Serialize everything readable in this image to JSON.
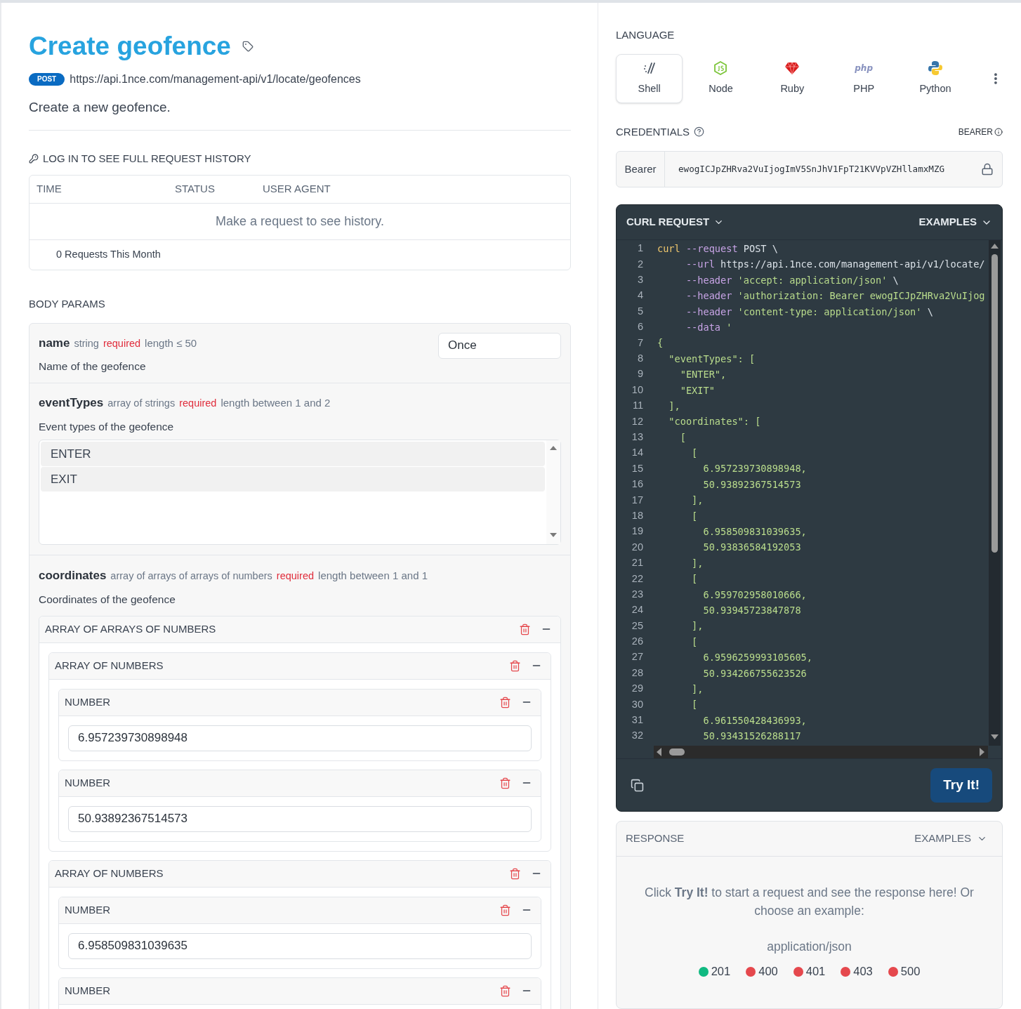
{
  "endpoint": {
    "title": "Create geofence",
    "method": "POST",
    "url": "https://api.1nce.com/management-api/v1/locate/geofences",
    "description": "Create a new geofence."
  },
  "history": {
    "heading": "LOG IN TO SEE FULL REQUEST HISTORY",
    "columns": [
      "TIME",
      "STATUS",
      "USER AGENT"
    ],
    "empty_message": "Make a request to see history.",
    "footer": "0 Requests This Month"
  },
  "body_params": {
    "heading": "BODY PARAMS",
    "params": [
      {
        "kind": "text",
        "name": "name",
        "type": "string",
        "required": "required",
        "constraint": "length ≤ 50",
        "description": "Name of the geofence",
        "value": "Once"
      },
      {
        "kind": "list",
        "name": "eventTypes",
        "type": "array of strings",
        "required": "required",
        "constraint": "length between 1 and 2",
        "description": "Event types of the geofence",
        "items": [
          "ENTER",
          "EXIT"
        ]
      },
      {
        "kind": "nested",
        "name": "coordinates",
        "type": "array of arrays of arrays of numbers",
        "required": "required",
        "constraint": "length between 1 and 1",
        "description": "Coordinates of the geofence",
        "groups": [
          {
            "label": "ARRAY OF ARRAYS OF NUMBERS",
            "children": [
              {
                "label": "ARRAY OF NUMBERS",
                "children": [
                  {
                    "label": "NUMBER",
                    "value": "6.957239730898948"
                  },
                  {
                    "label": "NUMBER",
                    "value": "50.93892367514573"
                  }
                ]
              },
              {
                "label": "ARRAY OF NUMBERS",
                "children": [
                  {
                    "label": "NUMBER",
                    "value": "6.958509831039635"
                  },
                  {
                    "label": "NUMBER"
                  }
                ]
              }
            ]
          }
        ]
      }
    ]
  },
  "language": {
    "heading": "LANGUAGE",
    "options": [
      {
        "label": "Shell",
        "kind": "shell",
        "selected": true
      },
      {
        "label": "Node",
        "kind": "node",
        "selected": false
      },
      {
        "label": "Ruby",
        "kind": "ruby",
        "selected": false
      },
      {
        "label": "PHP",
        "kind": "php",
        "logo_text": "php",
        "selected": false
      },
      {
        "label": "Python",
        "kind": "python",
        "selected": false
      }
    ]
  },
  "credentials": {
    "heading": "CREDENTIALS",
    "auth_type": "BEARER",
    "prefix": "Bearer",
    "token": "ewogICJpZHRva2VuIjogImV5SnJhV1FpT21KVVpVZHllamxMZG"
  },
  "request": {
    "title": "CURL REQUEST",
    "examples": "EXAMPLES",
    "try_button": "Try It!",
    "lines": [
      {
        "number": "1",
        "tokens": [
          {
            "kind": "command",
            "text": "curl"
          },
          {
            "kind": "flag",
            "text": " --request"
          },
          {
            "kind": "plain",
            "text": " POST \\"
          }
        ]
      },
      {
        "number": "2",
        "tokens": [
          {
            "kind": "flag",
            "text": "     --url"
          },
          {
            "kind": "plain",
            "text": " https://api.1nce.com/management-api/v1/locate/"
          }
        ]
      },
      {
        "number": "3",
        "tokens": [
          {
            "kind": "flag",
            "text": "     --header"
          },
          {
            "kind": "string",
            "text": " 'accept: application/json'"
          },
          {
            "kind": "plain",
            "text": " \\"
          }
        ]
      },
      {
        "number": "4",
        "tokens": [
          {
            "kind": "flag",
            "text": "     --header"
          },
          {
            "kind": "string",
            "text": " 'authorization: Bearer ewogICJpZHRva2VuIjog"
          }
        ]
      },
      {
        "number": "5",
        "tokens": [
          {
            "kind": "flag",
            "text": "     --header"
          },
          {
            "kind": "string",
            "text": " 'content-type: application/json'"
          },
          {
            "kind": "plain",
            "text": " \\"
          }
        ]
      },
      {
        "number": "6",
        "tokens": [
          {
            "kind": "flag",
            "text": "     --data"
          },
          {
            "kind": "string",
            "text": " '"
          }
        ]
      },
      {
        "number": "7",
        "tokens": [
          {
            "kind": "string",
            "text": "{"
          }
        ]
      },
      {
        "number": "8",
        "tokens": [
          {
            "kind": "string",
            "text": "  \"eventTypes\": ["
          }
        ]
      },
      {
        "number": "9",
        "tokens": [
          {
            "kind": "string",
            "text": "    \"ENTER\","
          }
        ]
      },
      {
        "number": "10",
        "tokens": [
          {
            "kind": "string",
            "text": "    \"EXIT\""
          }
        ]
      },
      {
        "number": "11",
        "tokens": [
          {
            "kind": "string",
            "text": "  ],"
          }
        ]
      },
      {
        "number": "12",
        "tokens": [
          {
            "kind": "string",
            "text": "  \"coordinates\": ["
          }
        ]
      },
      {
        "number": "13",
        "tokens": [
          {
            "kind": "string",
            "text": "    ["
          }
        ]
      },
      {
        "number": "14",
        "tokens": [
          {
            "kind": "string",
            "text": "      ["
          }
        ]
      },
      {
        "number": "15",
        "tokens": [
          {
            "kind": "string",
            "text": "        6.957239730898948,"
          }
        ]
      },
      {
        "number": "16",
        "tokens": [
          {
            "kind": "string",
            "text": "        50.93892367514573"
          }
        ]
      },
      {
        "number": "17",
        "tokens": [
          {
            "kind": "string",
            "text": "      ],"
          }
        ]
      },
      {
        "number": "18",
        "tokens": [
          {
            "kind": "string",
            "text": "      ["
          }
        ]
      },
      {
        "number": "19",
        "tokens": [
          {
            "kind": "string",
            "text": "        6.958509831039635,"
          }
        ]
      },
      {
        "number": "20",
        "tokens": [
          {
            "kind": "string",
            "text": "        50.93836584192053"
          }
        ]
      },
      {
        "number": "21",
        "tokens": [
          {
            "kind": "string",
            "text": "      ],"
          }
        ]
      },
      {
        "number": "22",
        "tokens": [
          {
            "kind": "string",
            "text": "      ["
          }
        ]
      },
      {
        "number": "23",
        "tokens": [
          {
            "kind": "string",
            "text": "        6.959702958010666,"
          }
        ]
      },
      {
        "number": "24",
        "tokens": [
          {
            "kind": "string",
            "text": "        50.93945723847878"
          }
        ]
      },
      {
        "number": "25",
        "tokens": [
          {
            "kind": "string",
            "text": "      ],"
          }
        ]
      },
      {
        "number": "26",
        "tokens": [
          {
            "kind": "string",
            "text": "      ["
          }
        ]
      },
      {
        "number": "27",
        "tokens": [
          {
            "kind": "string",
            "text": "        6.9596259993105605,"
          }
        ]
      },
      {
        "number": "28",
        "tokens": [
          {
            "kind": "string",
            "text": "        50.934266755623526"
          }
        ]
      },
      {
        "number": "29",
        "tokens": [
          {
            "kind": "string",
            "text": "      ],"
          }
        ]
      },
      {
        "number": "30",
        "tokens": [
          {
            "kind": "string",
            "text": "      ["
          }
        ]
      },
      {
        "number": "31",
        "tokens": [
          {
            "kind": "string",
            "text": "        6.961550428436993,"
          }
        ]
      },
      {
        "number": "32",
        "tokens": [
          {
            "kind": "string",
            "text": "        50.93431526288117"
          }
        ]
      }
    ]
  },
  "response": {
    "title": "RESPONSE",
    "examples": "EXAMPLES",
    "hint": "Click **Try It!** to start a request and see the response here! Or choose an example:",
    "content_type": "application/json",
    "codes": [
      {
        "code": "201",
        "color": "#10b981"
      },
      {
        "code": "400",
        "color": "#e5484d"
      },
      {
        "code": "401",
        "color": "#e5484d"
      },
      {
        "code": "403",
        "color": "#e5484d"
      },
      {
        "code": "500",
        "color": "#e5484d"
      }
    ]
  }
}
